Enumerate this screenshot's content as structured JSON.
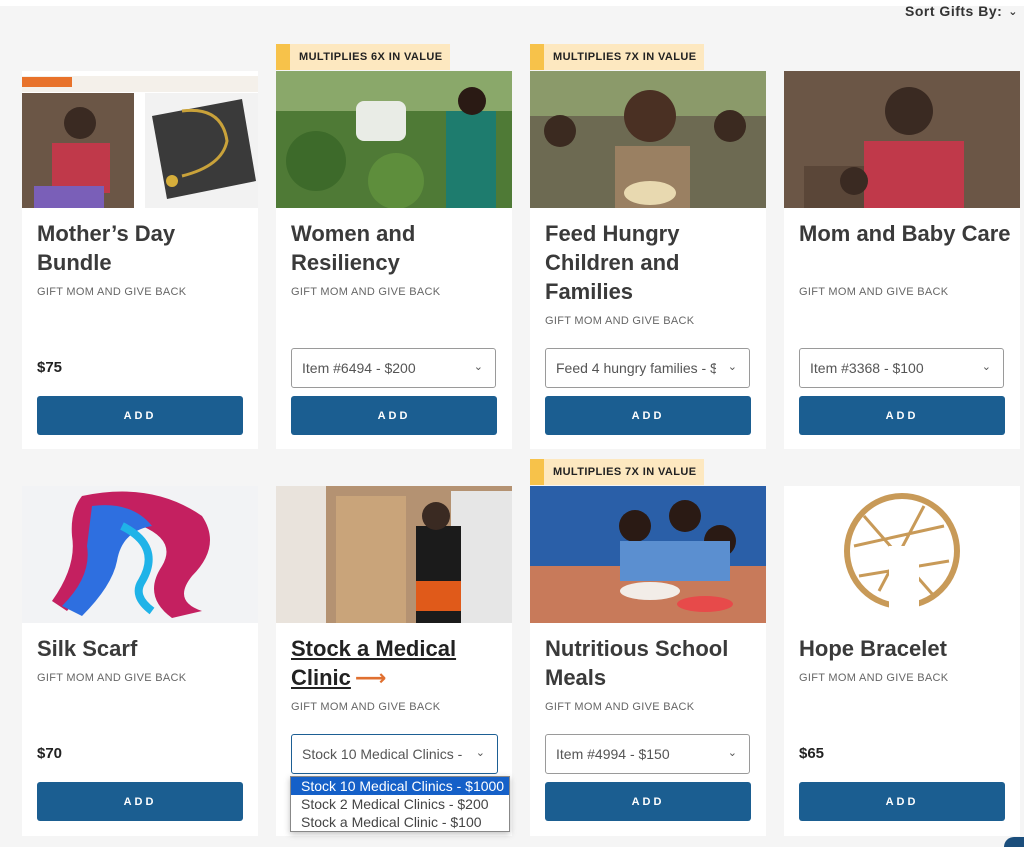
{
  "sort": {
    "label": "Sort Gifts By:"
  },
  "add_label": "ADD",
  "cards": [
    {
      "title": "Mother’s Day Bundle",
      "subtitle": "GIFT MOM AND GIVE BACK",
      "price": "$75"
    },
    {
      "title": "Women and Resiliency",
      "subtitle": "GIFT MOM AND GIVE BACK",
      "badge": "MULTIPLIES 6X IN VALUE",
      "select": "Item #6494 - $200"
    },
    {
      "title": "Feed Hungry Children and Families",
      "subtitle": "GIFT MOM AND GIVE BACK",
      "badge": "MULTIPLIES 7X IN VALUE",
      "select": "Feed 4 hungry families - $"
    },
    {
      "title": "Mom and Baby Care",
      "subtitle": "GIFT MOM AND GIVE BACK",
      "select": "Item #3368 - $100"
    },
    {
      "title": "Silk Scarf",
      "subtitle": "GIFT MOM AND GIVE BACK",
      "price": "$70"
    },
    {
      "title": "Stock a Medical Clinic",
      "subtitle": "GIFT MOM AND GIVE BACK",
      "select": "Stock 10 Medical Clinics -"
    },
    {
      "title": "Nutritious School Meals",
      "subtitle": "GIFT MOM AND GIVE BACK",
      "badge": "MULTIPLIES 7X IN VALUE",
      "select": "Item #4994 - $150"
    },
    {
      "title": "Hope Bracelet",
      "subtitle": "GIFT MOM AND GIVE BACK",
      "price": "$65"
    }
  ],
  "dropdown_options": [
    "Stock 10 Medical Clinics - $1000",
    "Stock 2 Medical Clinics - $200",
    "Stock a Medical Clinic - $100"
  ],
  "colors": {
    "button": "#1b5e91",
    "badge_bg": "#fde8c0",
    "badge_bar": "#f7c24a",
    "arrow": "#e07030",
    "selected_option": "#1560c8"
  }
}
